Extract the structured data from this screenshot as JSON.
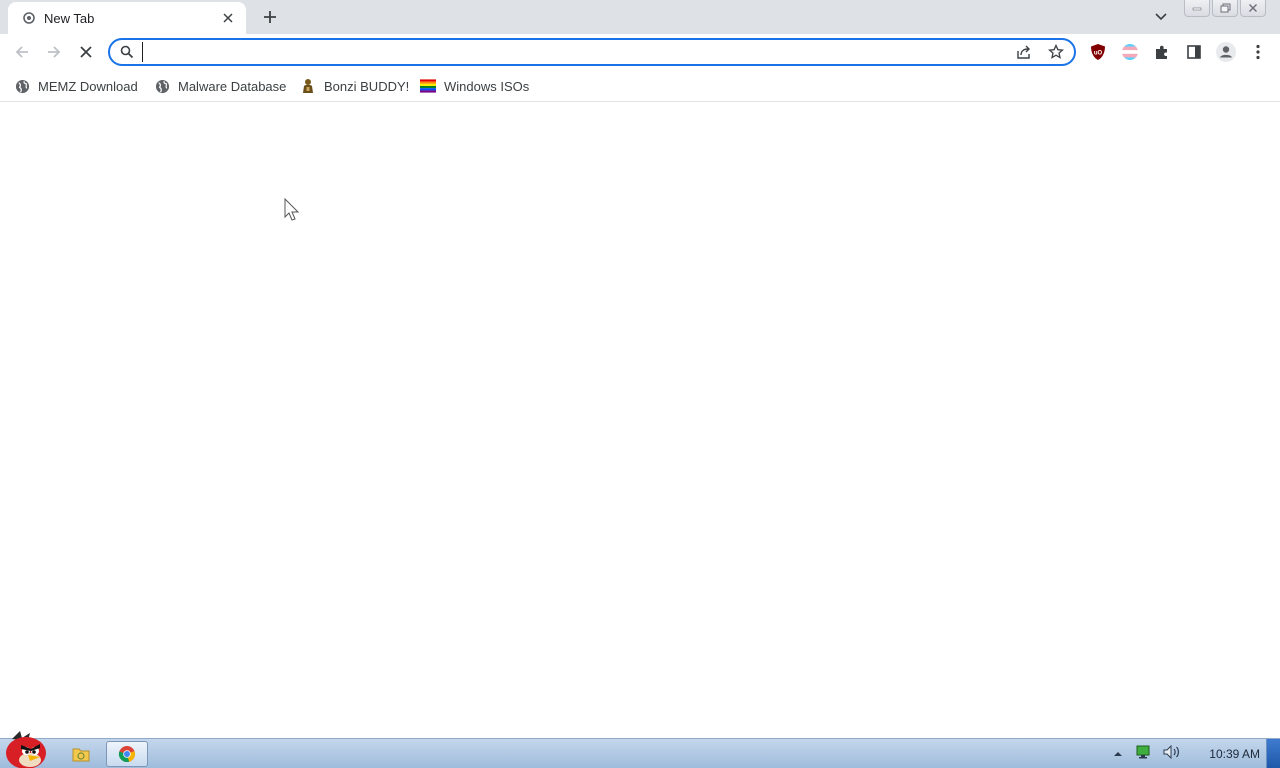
{
  "browser": {
    "tab": {
      "title": "New Tab",
      "favicon": "chrome-newtab-icon",
      "close_icon": "close-icon"
    },
    "new_tab_icon": "plus-icon",
    "tab_search_icon": "chevron-down-icon",
    "window_controls": [
      "minimize-icon",
      "restore-icon",
      "close-icon"
    ]
  },
  "toolbar": {
    "back_icon": "arrow-left-icon",
    "forward_icon": "arrow-right-icon",
    "stop_icon": "stop-x-icon",
    "omnibox": {
      "value": "",
      "placeholder": ""
    },
    "extensions": [
      "ublock-origin-icon",
      "pride-flag-extension-icon",
      "puzzle-icon",
      "side-panel-icon",
      "profile-icon",
      "kebab-menu-icon"
    ]
  },
  "bookmarks": [
    {
      "label": "MEMZ Download",
      "icon": "globe-icon"
    },
    {
      "label": "Malware Database",
      "icon": "globe-icon"
    },
    {
      "label": "Bonzi BUDDY!",
      "icon": "bonzi-icon"
    },
    {
      "label": "Windows ISOs",
      "icon": "rainbow-flag-icon"
    }
  ],
  "taskbar": {
    "start_icon": "angry-bird-orb-icon",
    "pinned": [
      "explorer-folder-icon",
      "chrome-icon"
    ],
    "tray_icons": [
      "show-hidden-icons-arrow",
      "network-icon",
      "volume-icon"
    ],
    "clock": "10:39 AM"
  },
  "colors": {
    "accent": "#1a73e8",
    "tabstrip": "#dee1e6",
    "taskbar": "#b1cae6"
  }
}
